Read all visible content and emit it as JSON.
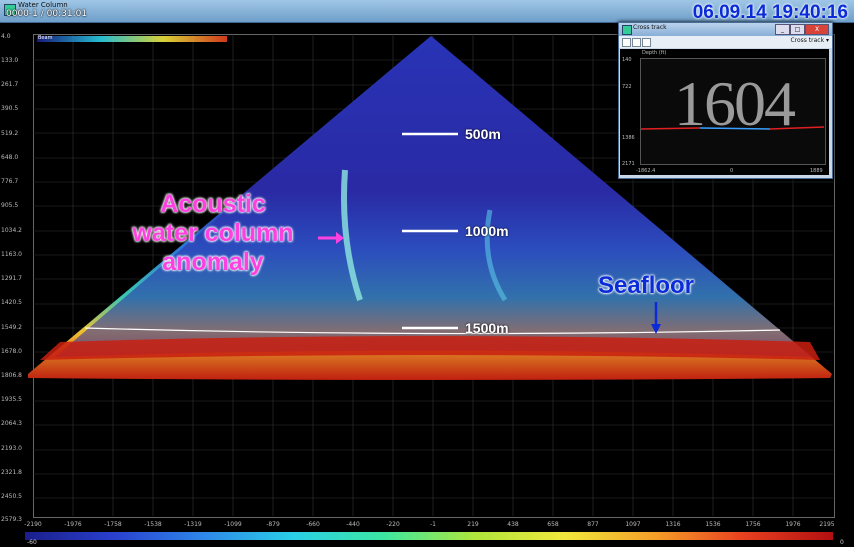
{
  "window": {
    "title": "Water Column",
    "time_readout": "0000-1 / 00:31:01",
    "datetime": "06.09.14 19:40:16"
  },
  "colorbar": {
    "min_label": "-60",
    "max_label": "0",
    "legend_label": "Beam"
  },
  "y_axis_ticks": [
    "4.0",
    "133.0",
    "261.7",
    "390.5",
    "519.2",
    "648.0",
    "776.7",
    "905.5",
    "1034.2",
    "1163.0",
    "1291.7",
    "1420.5",
    "1549.2",
    "1678.0",
    "1806.8",
    "1935.5",
    "2064.3",
    "2193.0",
    "2321.8",
    "2450.5",
    "2579.3"
  ],
  "x_axis_ticks": [
    "-2190",
    "-1976",
    "-1758",
    "-1538",
    "-1319",
    "-1099",
    "-879",
    "-660",
    "-440",
    "-220",
    "-1",
    "219",
    "438",
    "658",
    "877",
    "1097",
    "1316",
    "1536",
    "1756",
    "1976",
    "2195"
  ],
  "depth_markers": [
    {
      "label": "500m"
    },
    {
      "label": "1000m"
    },
    {
      "label": "1500m"
    }
  ],
  "annotations": {
    "anomaly_line1": "Acoustic",
    "anomaly_line2": "water column",
    "anomaly_line3": "anomaly",
    "seafloor": "Seafloor"
  },
  "cross_track": {
    "title": "Cross track",
    "dropdown": "Cross track",
    "ylabel": "Depth (ft)",
    "y_ticks": [
      "140",
      "722",
      "1386",
      "2171"
    ],
    "x_ticks": [
      "-1862.4",
      "0",
      "1889"
    ],
    "ping_number": "1604",
    "buttons": {
      "min": "_",
      "max": "□",
      "close": "X"
    }
  },
  "colors": {
    "accent": "#0b2bd8",
    "anomaly": "#ff40e0"
  }
}
